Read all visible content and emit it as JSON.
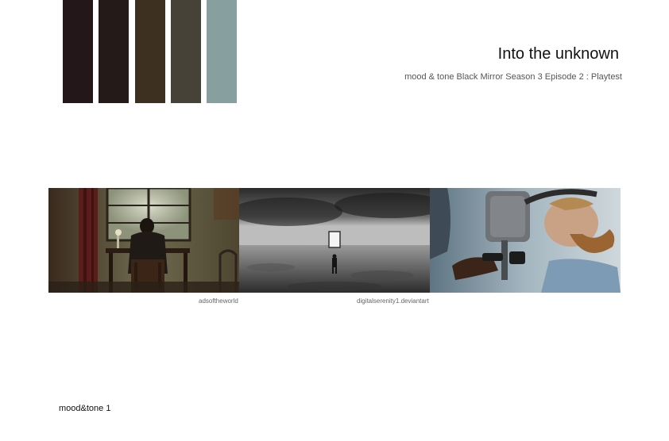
{
  "palette": {
    "colors": [
      "#231719",
      "#241a17",
      "#3e3020",
      "#464238",
      "#889f9f"
    ]
  },
  "header": {
    "title": "Into the unknown",
    "subtitle": "mood & tone Black Mirror Season 3 Episode 2 : Playtest"
  },
  "images": [
    {
      "icon": "photo-man-at-desk-window"
    },
    {
      "icon": "photo-figure-desert-doorway"
    },
    {
      "icon": "photo-man-headset-device"
    }
  ],
  "credits": [
    "adsoftheworld",
    "digitalserenity1.deviantart"
  ],
  "footer": {
    "label": "mood&tone 1"
  }
}
